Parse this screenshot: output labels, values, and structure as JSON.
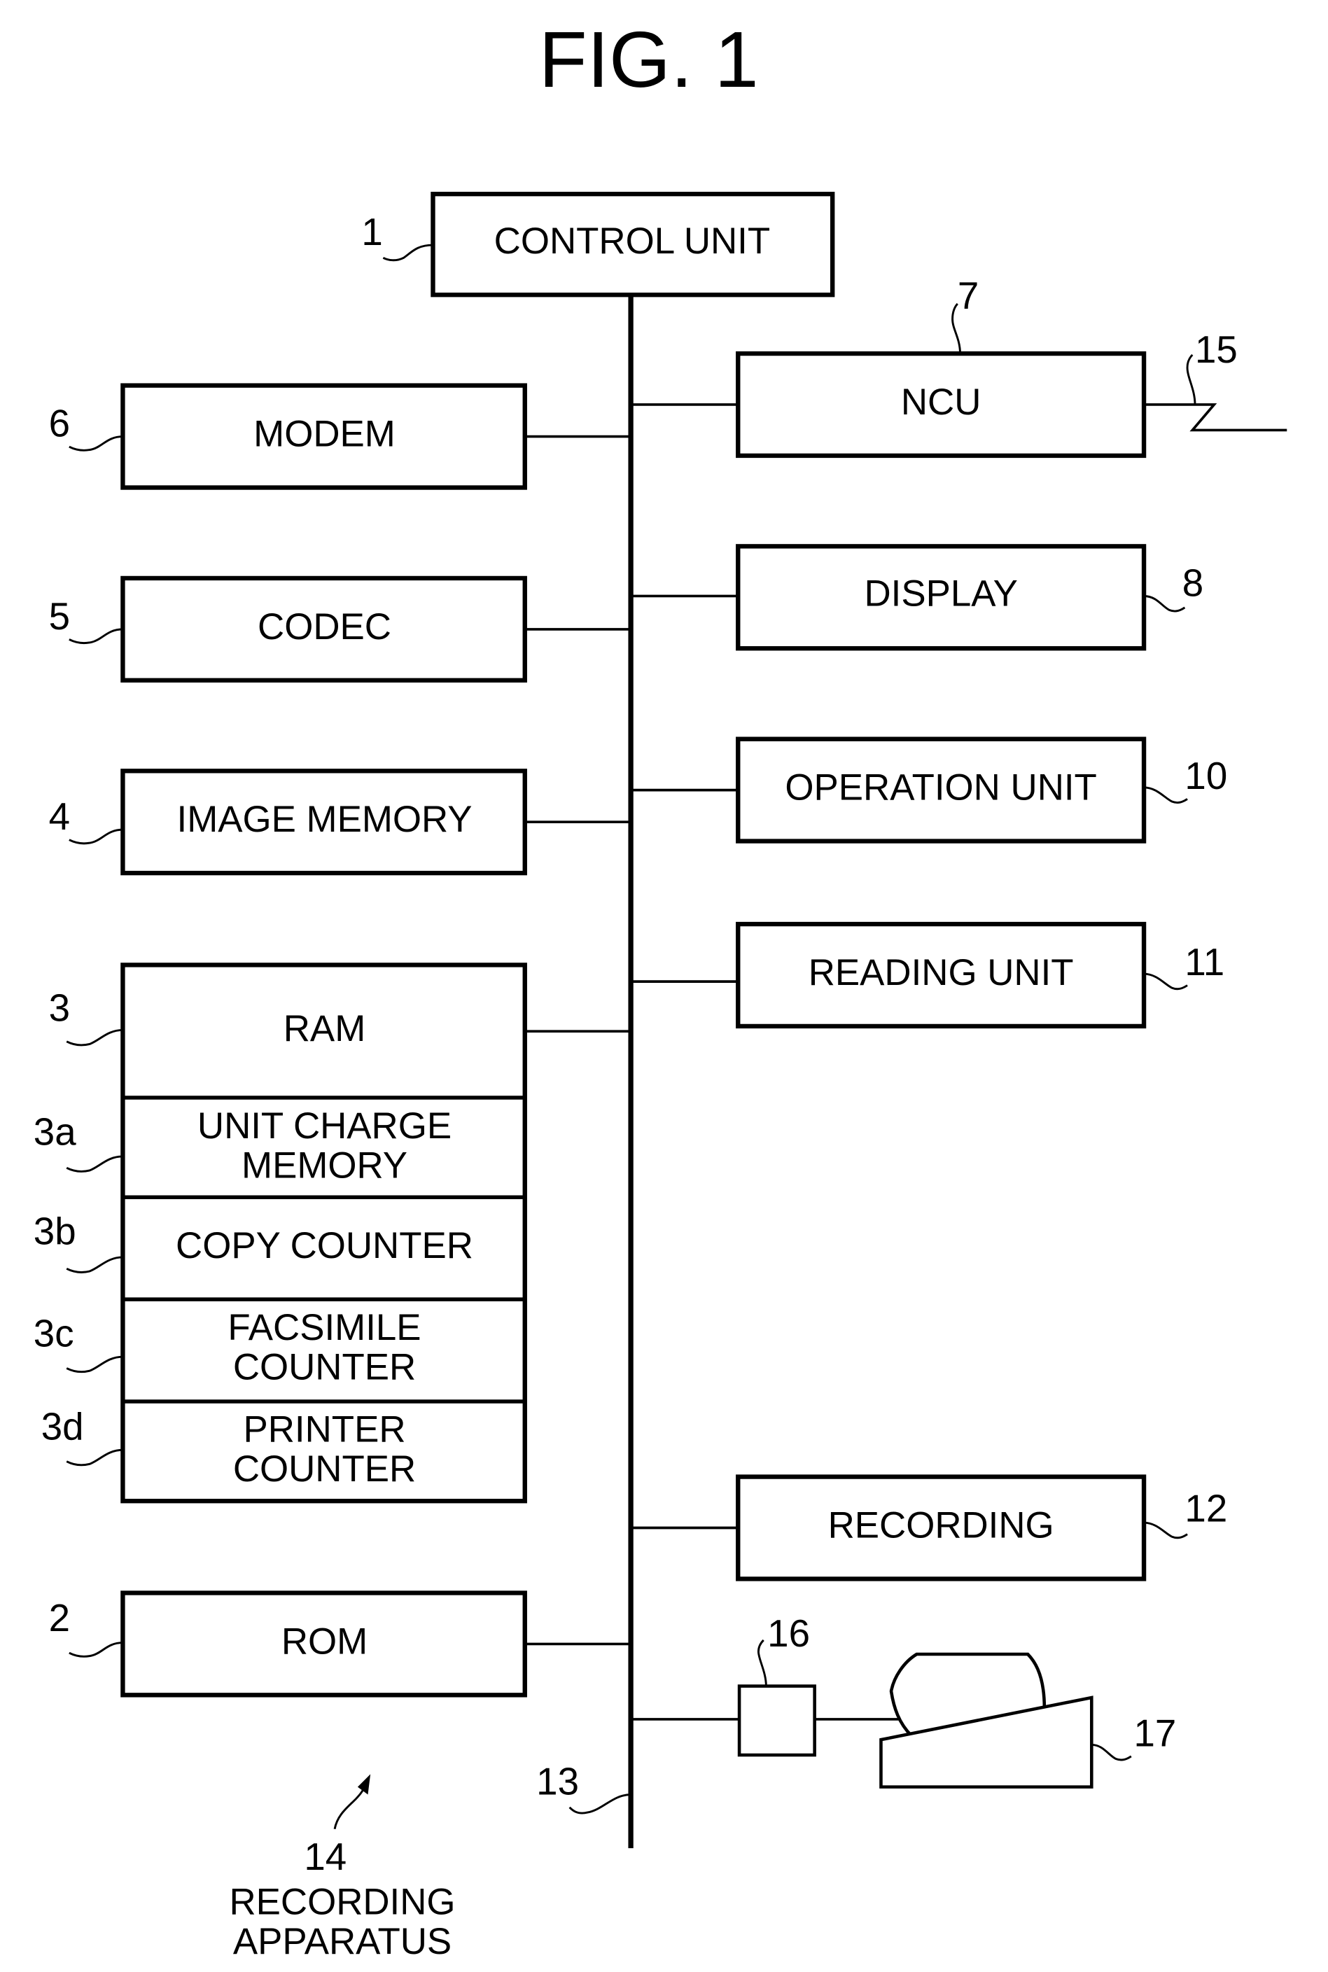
{
  "figure": {
    "title": "FIG. 1"
  },
  "blocks": {
    "control_unit": {
      "ref": "1",
      "label": "CONTROL UNIT"
    },
    "rom": {
      "ref": "2",
      "label": "ROM"
    },
    "ram": {
      "ref": "3",
      "label": "RAM"
    },
    "unit_charge_memory": {
      "ref": "3a",
      "line1": "UNIT CHARGE",
      "line2": "MEMORY"
    },
    "copy_counter": {
      "ref": "3b",
      "label": "COPY COUNTER"
    },
    "facsimile_counter": {
      "ref": "3c",
      "line1": "FACSIMILE",
      "line2": "COUNTER"
    },
    "printer_counter": {
      "ref": "3d",
      "line1": "PRINTER",
      "line2": "COUNTER"
    },
    "image_memory": {
      "ref": "4",
      "label": "IMAGE MEMORY"
    },
    "codec": {
      "ref": "5",
      "label": "CODEC"
    },
    "modem": {
      "ref": "6",
      "label": "MODEM"
    },
    "ncu": {
      "ref": "7",
      "label": "NCU"
    },
    "display": {
      "ref": "8",
      "label": "DISPLAY"
    },
    "operation_unit": {
      "ref": "10",
      "label": "OPERATION UNIT"
    },
    "reading_unit": {
      "ref": "11",
      "label": "READING UNIT"
    },
    "recording": {
      "ref": "12",
      "label": "RECORDING"
    },
    "bus": {
      "ref": "13"
    },
    "apparatus": {
      "ref": "14",
      "line1": "RECORDING",
      "line2": "APPARATUS"
    },
    "telephone_line": {
      "ref": "15"
    },
    "interface": {
      "ref": "16"
    },
    "external_device": {
      "ref": "17"
    }
  }
}
